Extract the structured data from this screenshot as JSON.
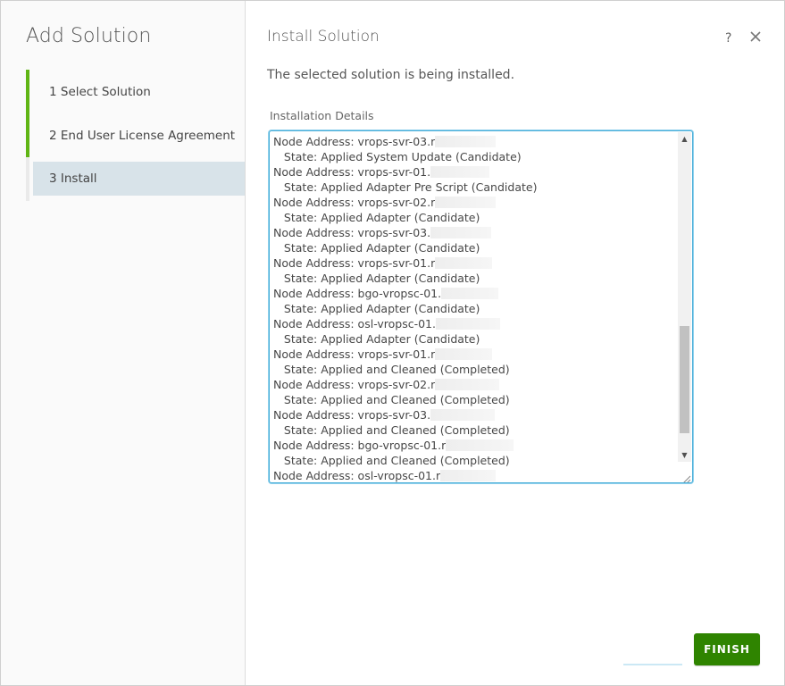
{
  "sidebar": {
    "title": "Add Solution",
    "steps": [
      {
        "label": "1  Select Solution",
        "state": "completed"
      },
      {
        "label": "2 End User License Agreement",
        "state": "completed"
      },
      {
        "label": "3 Install",
        "state": "active"
      }
    ]
  },
  "main": {
    "title": "Install Solution",
    "status_text": "The selected solution is being installed.",
    "details_label": "Installation Details",
    "details_lines": [
      "Node Address: vrops-svr-03.r",
      "   State: Applied System Update (Candidate)",
      "Node Address: vrops-svr-01.",
      "   State: Applied Adapter Pre Script (Candidate)",
      "Node Address: vrops-svr-02.r",
      "   State: Applied Adapter (Candidate)",
      "Node Address: vrops-svr-03.",
      "   State: Applied Adapter (Candidate)",
      "Node Address: vrops-svr-01.r",
      "   State: Applied Adapter (Candidate)",
      "Node Address: bgo-vropsc-01.",
      "   State: Applied Adapter (Candidate)",
      "Node Address: osl-vropsc-01.",
      "   State: Applied Adapter (Candidate)",
      "Node Address: vrops-svr-01.r",
      "   State: Applied and Cleaned (Completed)",
      "Node Address: vrops-svr-02.r",
      "   State: Applied and Cleaned (Completed)",
      "Node Address: vrops-svr-03.",
      "   State: Applied and Cleaned (Completed)",
      "Node Address: bgo-vropsc-01.r",
      "   State: Applied and Cleaned (Completed)",
      "Node Address: osl-vropsc-01.r"
    ],
    "scroll_position": 0.78
  },
  "header_icons": {
    "help": "?",
    "close": "close-icon"
  },
  "footer": {
    "finish_label": "FINISH"
  },
  "colors": {
    "accent_green": "#60b515",
    "button_green": "#2f8400",
    "focus_blue": "#49afd9",
    "active_step_bg": "#d8e3e9"
  }
}
